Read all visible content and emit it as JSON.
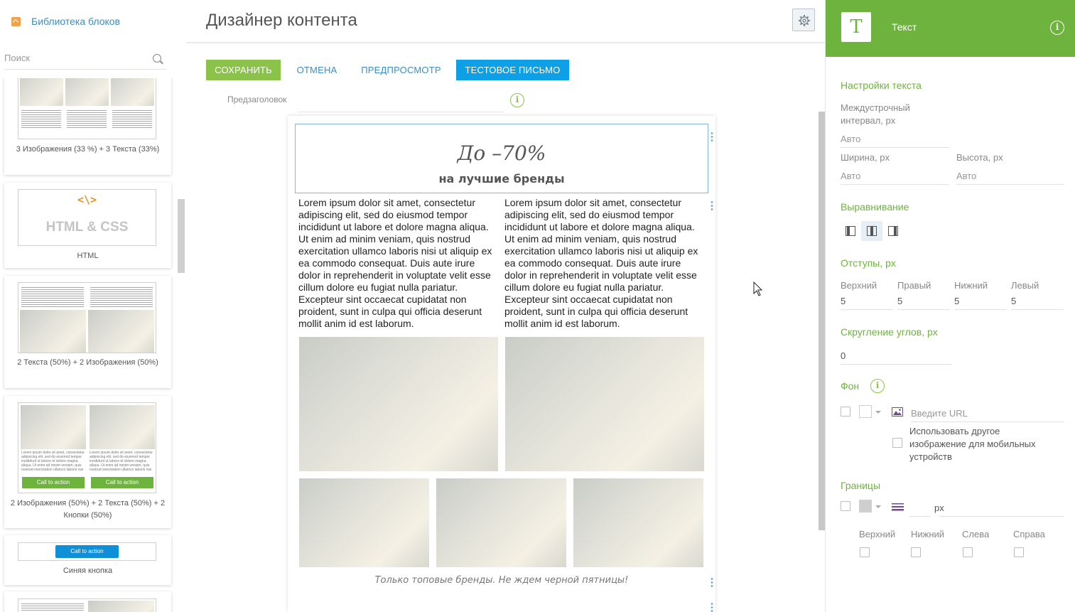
{
  "library": {
    "title": "Библиотека блоков",
    "search_placeholder": "Поиск",
    "blocks": [
      {
        "caption": "3 Изображения (33 %) + 3 Текста (33%)"
      },
      {
        "caption": "HTML",
        "thumb_title": "HTML & CSS",
        "thumb_symbol": "<\\>"
      },
      {
        "caption": "2 Текста (50%) + 2 Изображения (50%)"
      },
      {
        "caption": "2 Изображения (50%) + 2 Текста (50%) + 2 Кнопки (50%)",
        "thumb_buttons": [
          "Call to action",
          "Call to action"
        ],
        "thumb_text": "Lorem ipsum dolor sit amet, consectetur adipiscing elit, sed do eiusmod tempor incididunt ut labore et dolore magna aliqua. Ut enim ad minim veniam, quis nostrud exercitation ullamco laboris nisi ut aliquip ex"
      },
      {
        "caption": "Синяя кнопка",
        "thumb_button": "Call to action"
      }
    ]
  },
  "header": {
    "title": "Дизайнер контента",
    "settings_icon": "gear-icon"
  },
  "toolbar": {
    "save": "Сохранить",
    "cancel": "Отмена",
    "preview": "Предпросмотр",
    "test_email": "Тестовое письмо"
  },
  "preheader": {
    "label": "Предзаголовок",
    "value": ""
  },
  "email": {
    "headline": "До –70%",
    "subheadline": "на лучшие бренды",
    "text_left": "Lorem ipsum dolor sit amet, consectetur adipiscing elit, sed do eiusmod tempor incididunt ut labore et dolore magna aliqua. Ut enim ad minim veniam, quis nostrud exercitation ullamco laboris nisi ut aliquip ex ea commodo consequat. Duis aute irure dolor in reprehenderit in voluptate velit esse cillum dolore eu fugiat nulla pariatur. Excepteur sint occaecat cupidatat non proident, sunt in culpa qui officia deserunt mollit anim id est laborum.",
    "text_right": "Lorem ipsum dolor sit amet, consectetur adipiscing elit, sed do eiusmod tempor incididunt ut labore et dolore magna aliqua. Ut enim ad minim veniam, quis nostrud exercitation ullamco laboris nisi ut aliquip ex ea commodo consequat. Duis aute irure dolor in reprehenderit in voluptate velit esse cillum dolore eu fugiat nulla pariatur. Excepteur sint occaecat cupidatat non proident, sunt in culpa qui officia deserunt mollit anim id est laborum.",
    "footer": "Только топовые бренды. Не ждем черной пятницы!"
  },
  "panel": {
    "title": "Текст",
    "icon_letter": "T",
    "info_symbol": "i",
    "text_settings": "Настройки текста",
    "line_height_label": "Междустрочный интервал, px",
    "line_height_value": "Авто",
    "width_label": "Ширина, px",
    "width_value": "Авто",
    "height_label": "Высота, px",
    "height_value": "Авто",
    "alignment": "Выравнивание",
    "alignment_selected": "center",
    "padding": "Отступы, px",
    "padding_top_label": "Верхний",
    "padding_right_label": "Правый",
    "padding_bottom_label": "Нижний",
    "padding_left_label": "Левый",
    "padding_top": "5",
    "padding_right": "5",
    "padding_bottom": "5",
    "padding_left": "5",
    "radius": "Скругление углов, px",
    "radius_value": "0",
    "background": "Фон",
    "url_placeholder": "Введите URL",
    "mobile_image": "Использовать другое изображение для мобильных устройств",
    "borders": "Границы",
    "border_unit": "px",
    "border_top": "Верхний",
    "border_bottom": "Нижний",
    "border_left": "Слева",
    "border_right": "Справа"
  },
  "colors": {
    "accent_green": "#6eb33d",
    "save_green": "#8bc34a",
    "link_blue": "#3b8cc9",
    "test_blue": "#0ea0e6",
    "lib_orange": "#f0a24a"
  }
}
